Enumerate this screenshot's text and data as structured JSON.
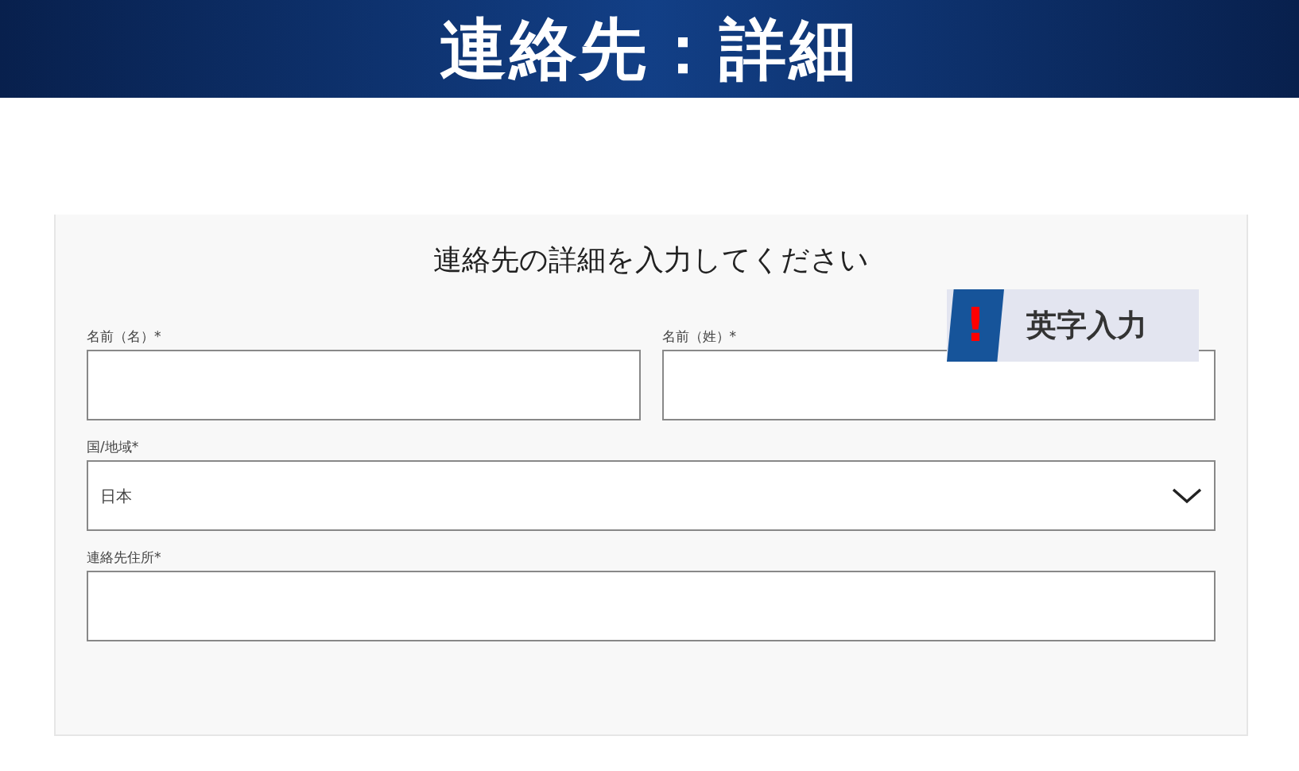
{
  "banner": {
    "title": "連絡先：詳細"
  },
  "form": {
    "heading": "連絡先の詳細を入力してください",
    "rows": [
      [
        {
          "kind": "text",
          "label": "名前（名）*"
        },
        {
          "kind": "text",
          "label": "名前（姓）*"
        }
      ],
      [
        {
          "kind": "select",
          "label": "国/地域*",
          "value": "日本"
        }
      ],
      [
        {
          "kind": "text",
          "label": "連絡先住所*"
        }
      ]
    ]
  },
  "callout": {
    "mark": "!",
    "text": "英字入力"
  }
}
